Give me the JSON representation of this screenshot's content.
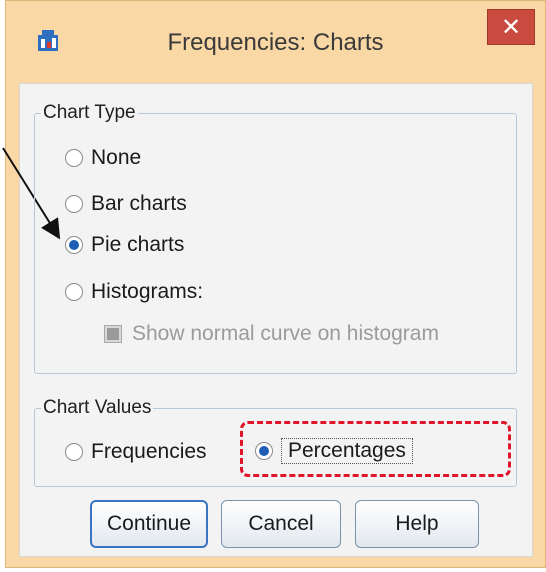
{
  "window": {
    "title": "Frequencies: Charts",
    "close_glyph": "✕"
  },
  "chart_type": {
    "legend": "Chart Type",
    "options": [
      {
        "label": "None",
        "selected": false
      },
      {
        "label": "Bar charts",
        "selected": false
      },
      {
        "label": "Pie charts",
        "selected": true
      },
      {
        "label": "Histograms:",
        "selected": false
      }
    ],
    "show_normal_curve": {
      "label": "Show normal curve on histogram",
      "enabled": false,
      "checked": false
    }
  },
  "chart_values": {
    "legend": "Chart Values",
    "options": [
      {
        "label": "Frequencies",
        "selected": false
      },
      {
        "label": "Percentages",
        "selected": true
      }
    ]
  },
  "buttons": {
    "continue": "Continue",
    "cancel": "Cancel",
    "help": "Help"
  },
  "colors": {
    "accent": "#1e5fb3",
    "highlight": "#e0152a",
    "frame": "#f9d8a5",
    "close": "#c94a3e"
  }
}
